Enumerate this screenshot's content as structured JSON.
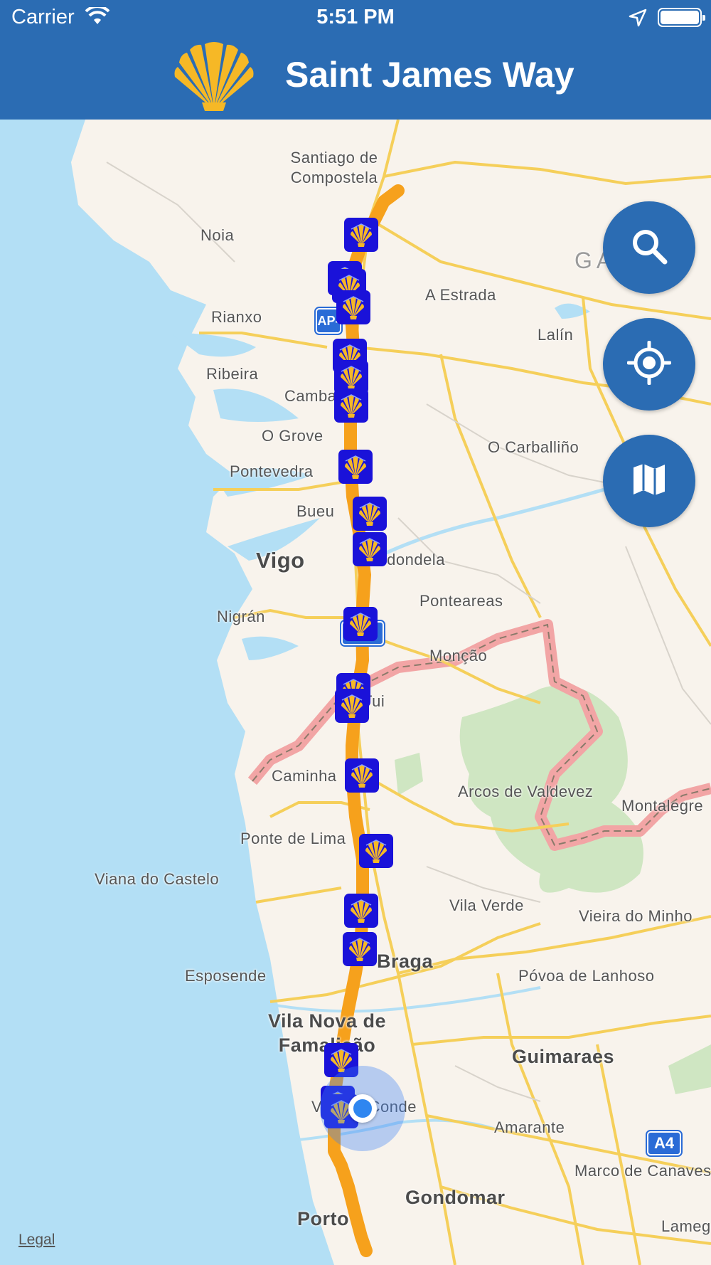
{
  "status": {
    "carrier": "Carrier",
    "time": "5:51 PM"
  },
  "nav": {
    "title": "Saint James Way",
    "logo_icon": "scallop-shell-icon"
  },
  "map": {
    "places": [
      "Santiago de Compostela",
      "Noia",
      "Rianxo",
      "Ribeira",
      "A Estrada",
      "Lalín",
      "Cambados",
      "O Grove",
      "Pontevedra",
      "O Carballiño",
      "Bueu",
      "Vigo",
      "Redondela",
      "Ponteareas",
      "Nigrán",
      "Monção",
      "Tui",
      "Caminha",
      "Arcos de Valdevez",
      "Montalegre",
      "Ponte de Lima",
      "Viana do Castelo",
      "Vila Verde",
      "Vieira do Minho",
      "Braga",
      "Esposende",
      "Póvoa de Lanhoso",
      "Vila Nova de Famalicão",
      "Guimaraes",
      "Vila Do Conde",
      "Amarante",
      "Marco de Canaveses",
      "Gondomar",
      "Porto",
      "Lamego",
      "GALICIA"
    ],
    "route_shields": [
      "AP-9",
      "A4",
      "A-55"
    ],
    "legal": "Legal",
    "route_color": "#f6a11c",
    "marker_color": "#1a12d9"
  },
  "controls": {
    "search_icon": "search-icon",
    "locate_icon": "crosshair-icon",
    "map_mode_icon": "map-icon"
  }
}
